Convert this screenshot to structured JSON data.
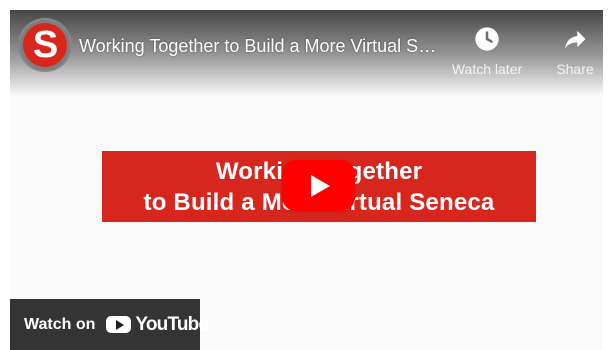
{
  "player": {
    "title": "Working Together to Build a More Virtual Seneca",
    "channel_initial": "S",
    "actions": {
      "watch_later_label": "Watch later",
      "share_label": "Share"
    },
    "banner": {
      "line1": "Working Together",
      "line2": "to Build a More Virtual Seneca"
    },
    "watch_on": {
      "label": "Watch on",
      "brand": "YouTube"
    },
    "icons": {
      "channel": "channel-avatar-icon",
      "watch_later": "clock-icon",
      "share": "share-arrow-icon",
      "play": "play-icon",
      "youtube": "youtube-logo-icon"
    },
    "colors": {
      "banner_red": "#d7261e",
      "play_red": "#ff0000",
      "channel_red": "#d9261c",
      "watch_on_bg": "#1e1e1e"
    }
  }
}
